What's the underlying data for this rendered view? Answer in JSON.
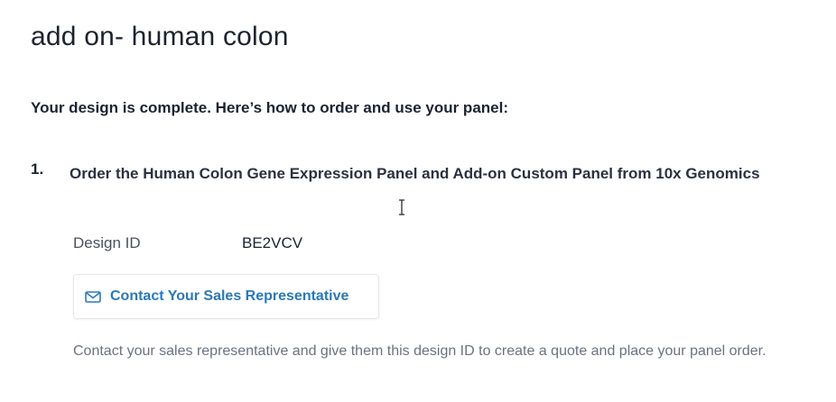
{
  "page": {
    "title": "add on- human colon",
    "subtitle": "Your design is complete. Here’s how to order and use your panel:"
  },
  "steps": [
    {
      "number": "1.",
      "text": "Order the Human Colon Gene Expression Panel and Add-on Custom Panel from 10x Genomics",
      "design_id_label": "Design ID",
      "design_id_value": "BE2VCV",
      "contact_button_label": "Contact Your Sales Representative",
      "contact_button_icon": "mail-icon",
      "help_text": "Contact your sales representative and give them this design ID to create a quote and place your panel order."
    }
  ],
  "colors": {
    "accent": "#2a79b8",
    "heading": "#1b2331",
    "muted": "#6b7280"
  },
  "cursor": "text-cursor-icon"
}
